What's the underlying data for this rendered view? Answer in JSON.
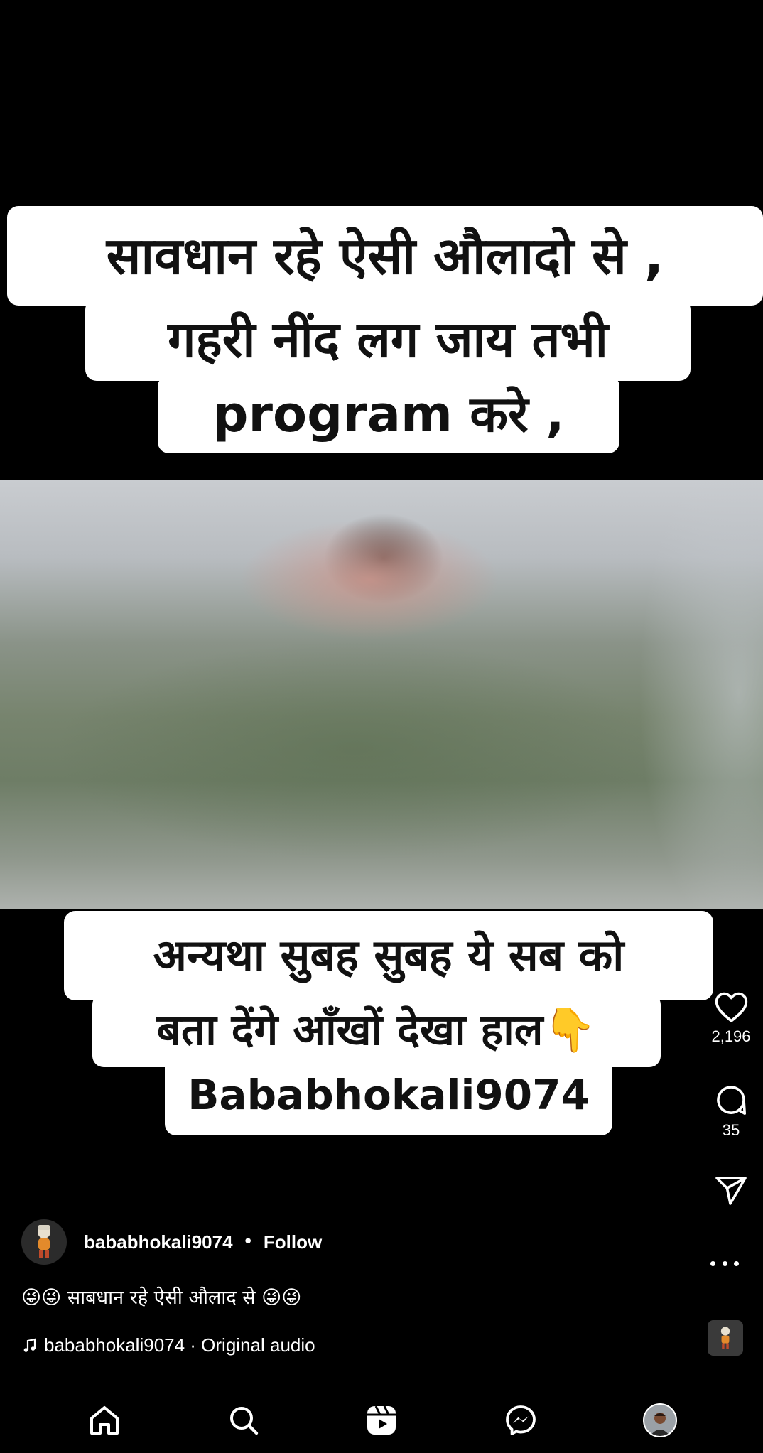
{
  "video": {
    "caption_top": [
      "सावधान रहे ऐसी औलादो से ,",
      "गहरी नींद लग जाय तभी",
      "program करे ,"
    ],
    "caption_bottom": [
      "अन्यथा सुबह सुबह ये सब को",
      "बता देंगे आँखों देखा हाल👇",
      "Bababhokali9074"
    ]
  },
  "actions": {
    "likes": "2,196",
    "comments": "35"
  },
  "post": {
    "username": "bababhokali9074",
    "separator": "•",
    "follow_label": "Follow",
    "caption": "😜😜 साबधान रहे ऐसी औलाद से 😜😜",
    "audio": "bababhokali9074 · Original audio"
  },
  "nav": {
    "items": [
      "home-icon",
      "search-icon",
      "reels-icon",
      "messenger-icon",
      "profile-avatar"
    ]
  },
  "colors": {
    "background": "#000000",
    "text": "#ffffff",
    "caption_box": "#ffffff"
  }
}
